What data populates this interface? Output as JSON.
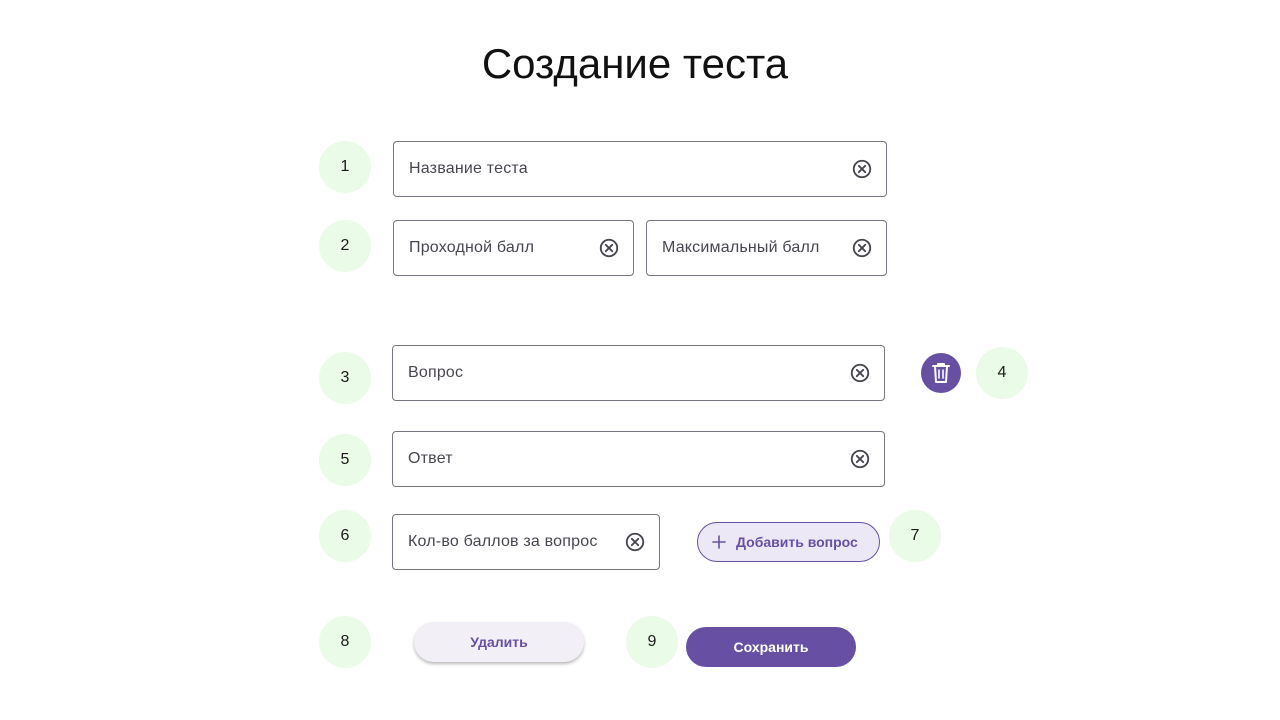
{
  "header": {
    "title": "Создание теста"
  },
  "markers": [
    "1",
    "2",
    "3",
    "4",
    "5",
    "6",
    "7",
    "8",
    "9"
  ],
  "fields": {
    "test_name": {
      "label": "Название теста"
    },
    "passing_score": {
      "label": "Проходной балл"
    },
    "max_score": {
      "label": "Максимальный балл"
    },
    "question": {
      "label": "Вопрос"
    },
    "answer": {
      "label": "Ответ"
    },
    "question_points": {
      "label": "Кол-во баллов за вопрос"
    }
  },
  "buttons": {
    "add_question": "Добавить вопрос",
    "delete": "Удалить",
    "save": "Сохранить"
  },
  "icons": {
    "clear": "clear-circle-icon",
    "trash": "trash-icon",
    "plus": "plus-icon"
  },
  "colors": {
    "primary": "#6750a4",
    "marker_bg": "#eafbe7",
    "outline": "#79747e",
    "add_bg": "#ece8f6",
    "delete_bg": "#f3eff7"
  }
}
